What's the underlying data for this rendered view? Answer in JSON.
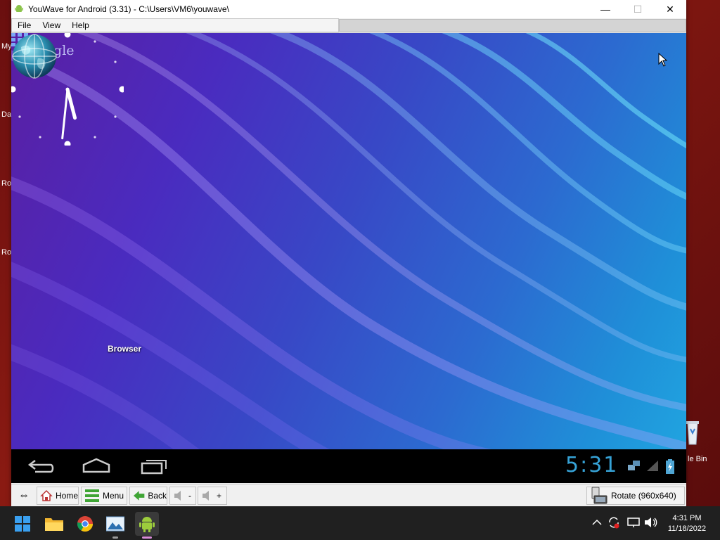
{
  "desktop": {
    "labels": [
      "My",
      "Da",
      "Ro",
      "Ro"
    ],
    "recycle_bin_label": "le Bin"
  },
  "window": {
    "title": "YouWave for Android (3.31) - C:\\Users\\VM6\\youwave\\",
    "controls": {
      "minimize": "—",
      "maximize": "☐",
      "close": "✕"
    },
    "menu": [
      {
        "label": "File",
        "key": "F"
      },
      {
        "label": "View",
        "key": "V"
      },
      {
        "label": "Help",
        "key": "H"
      }
    ]
  },
  "android": {
    "search_label": "Google",
    "apps": [
      {
        "label": "Browser",
        "icon": "globe-icon"
      }
    ],
    "clock": {
      "hour": 5,
      "minute": 31
    },
    "status_time": "5:31",
    "nav_buttons": [
      "back-icon",
      "home-icon",
      "recent-apps-icon"
    ],
    "colors": {
      "accent": "#36a2d6",
      "wallpaper_left": "#5a1fa3",
      "wallpaper_right": "#20a4e0"
    }
  },
  "toolbar": {
    "resize_icon": "⇔",
    "home_label": "Home",
    "menu_label": "Menu",
    "back_label": "Back",
    "volume_down_label": "-",
    "volume_up_label": "+",
    "rotate_label": "Rotate (960x640)"
  },
  "taskbar": {
    "pinned": [
      "windows-start-icon",
      "file-explorer-icon",
      "chrome-icon",
      "photos-icon",
      "youwave-icon"
    ],
    "time": "4:31 PM",
    "date": "11/18/2022"
  }
}
